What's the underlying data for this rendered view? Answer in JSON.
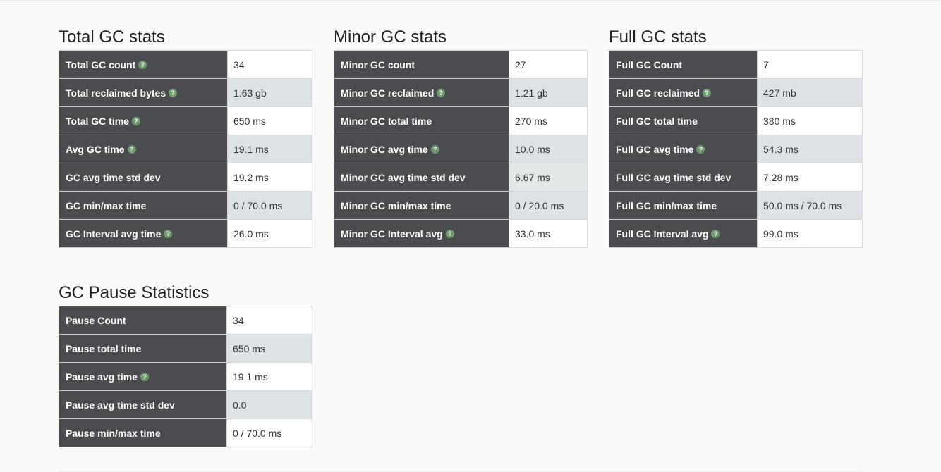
{
  "total": {
    "title": "Total GC stats",
    "rows": [
      {
        "label": "Total GC count",
        "value": "34"
      },
      {
        "label": "Total reclaimed bytes",
        "value": "1.63 gb"
      },
      {
        "label": "Total GC time",
        "value": "650 ms"
      },
      {
        "label": "Avg GC time",
        "value": "19.1 ms"
      },
      {
        "label": "GC avg time std dev",
        "value": "19.2 ms"
      },
      {
        "label": "GC min/max time",
        "value": "0 / 70.0 ms"
      },
      {
        "label": "GC Interval avg time",
        "value": "26.0 ms"
      }
    ]
  },
  "minor": {
    "title": "Minor GC stats",
    "rows": [
      {
        "label": "Minor GC count",
        "value": "27"
      },
      {
        "label": "Minor GC reclaimed",
        "value": "1.21 gb"
      },
      {
        "label": "Minor GC total time",
        "value": "270 ms"
      },
      {
        "label": "Minor GC avg time",
        "value": "10.0 ms"
      },
      {
        "label": "Minor GC avg time std dev",
        "value": "6.67 ms"
      },
      {
        "label": "Minor GC min/max time",
        "value": "0 / 20.0 ms"
      },
      {
        "label": "Minor GC Interval avg",
        "value": "33.0 ms"
      }
    ]
  },
  "full": {
    "title": "Full GC stats",
    "rows": [
      {
        "label": "Full GC Count",
        "value": "7"
      },
      {
        "label": "Full GC reclaimed",
        "value": "427 mb"
      },
      {
        "label": "Full GC total time",
        "value": "380 ms"
      },
      {
        "label": "Full GC avg time",
        "value": "54.3 ms"
      },
      {
        "label": "Full GC avg time std dev",
        "value": "7.28 ms"
      },
      {
        "label": "Full GC min/max time",
        "value": "50.0 ms / 70.0 ms"
      },
      {
        "label": "Full GC Interval avg",
        "value": "99.0 ms"
      }
    ]
  },
  "pause": {
    "title": "GC Pause Statistics",
    "rows": [
      {
        "label": "Pause Count",
        "value": "34"
      },
      {
        "label": "Pause total time",
        "value": "650 ms"
      },
      {
        "label": "Pause avg time",
        "value": "19.1 ms"
      },
      {
        "label": "Pause avg time std dev",
        "value": "0.0"
      },
      {
        "label": "Pause min/max time",
        "value": "0 / 70.0 ms"
      }
    ]
  },
  "help_icon": "question-help-icon",
  "help_glyph": "?",
  "colors": {
    "label_bg": "#4a4c50",
    "alt_row_bg": "#dde2e7",
    "help_icon": "#6e9a6c"
  }
}
